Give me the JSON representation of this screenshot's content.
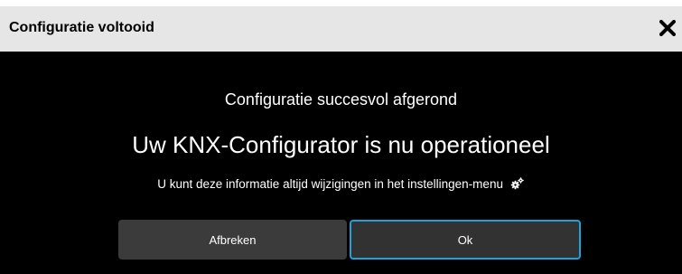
{
  "dialog": {
    "title": "Configuratie voltooid",
    "close_glyph": "✕",
    "close_icon": "close-icon",
    "heading": "Configuratie succesvol afgerond",
    "main_message": "Uw KNX-Configurator is nu operationeel",
    "info_text": "U kunt deze informatie altijd wijzigingen in het instellingen-menu",
    "settings_icon": "gear-icon",
    "cancel_label": "Afbreken",
    "ok_label": "Ok"
  },
  "colors": {
    "titlebar_bg": "#e6e6e6",
    "dialog_bg": "#000000",
    "button_bg": "#3b3b3b",
    "focus_border": "#1aa3dd"
  }
}
